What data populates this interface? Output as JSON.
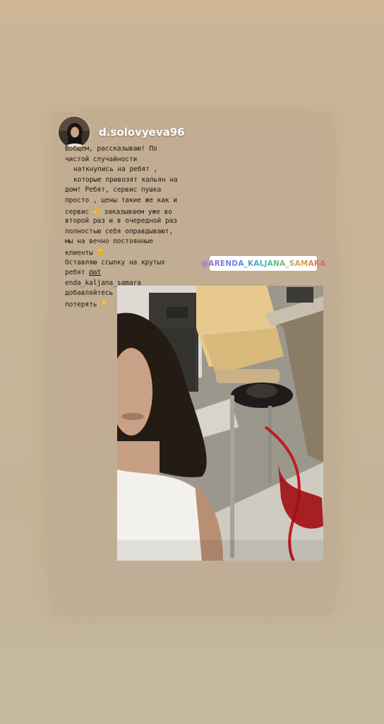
{
  "story": {
    "username": "d.solovyeva96",
    "caption_lines": [
      "Вобщем, рассказываю! По",
      "чистой случайности",
      "наткнулись на ребят ,",
      "которые привозят кальян на",
      "дом! Ребят, сервис пушка",
      "просто , цены такие же как и",
      "сервис",
      "заказываем уже во",
      "второй раз и в очередной раз",
      "полностью себя оправдывают,",
      "мы на вечно постоянные",
      "клиенты",
      "Оставляю ссылку на крутых",
      "ребят",
      "@at",
      "enda_kaljana_samara",
      "добавляйтесь к ним, чтобы не",
      "потерять"
    ],
    "emoji_1": "👍",
    "emoji_2": "😊",
    "emoji_3": "👇",
    "mention_sticker": "@ARENDA_KALJANA_SAMARA"
  },
  "colors": {
    "background": "#c8b598",
    "caption_text": "#1d1711",
    "username_text": "#ffffff"
  },
  "icons": {
    "avatar": "user-avatar",
    "photo": "selfie-with-hookah"
  }
}
